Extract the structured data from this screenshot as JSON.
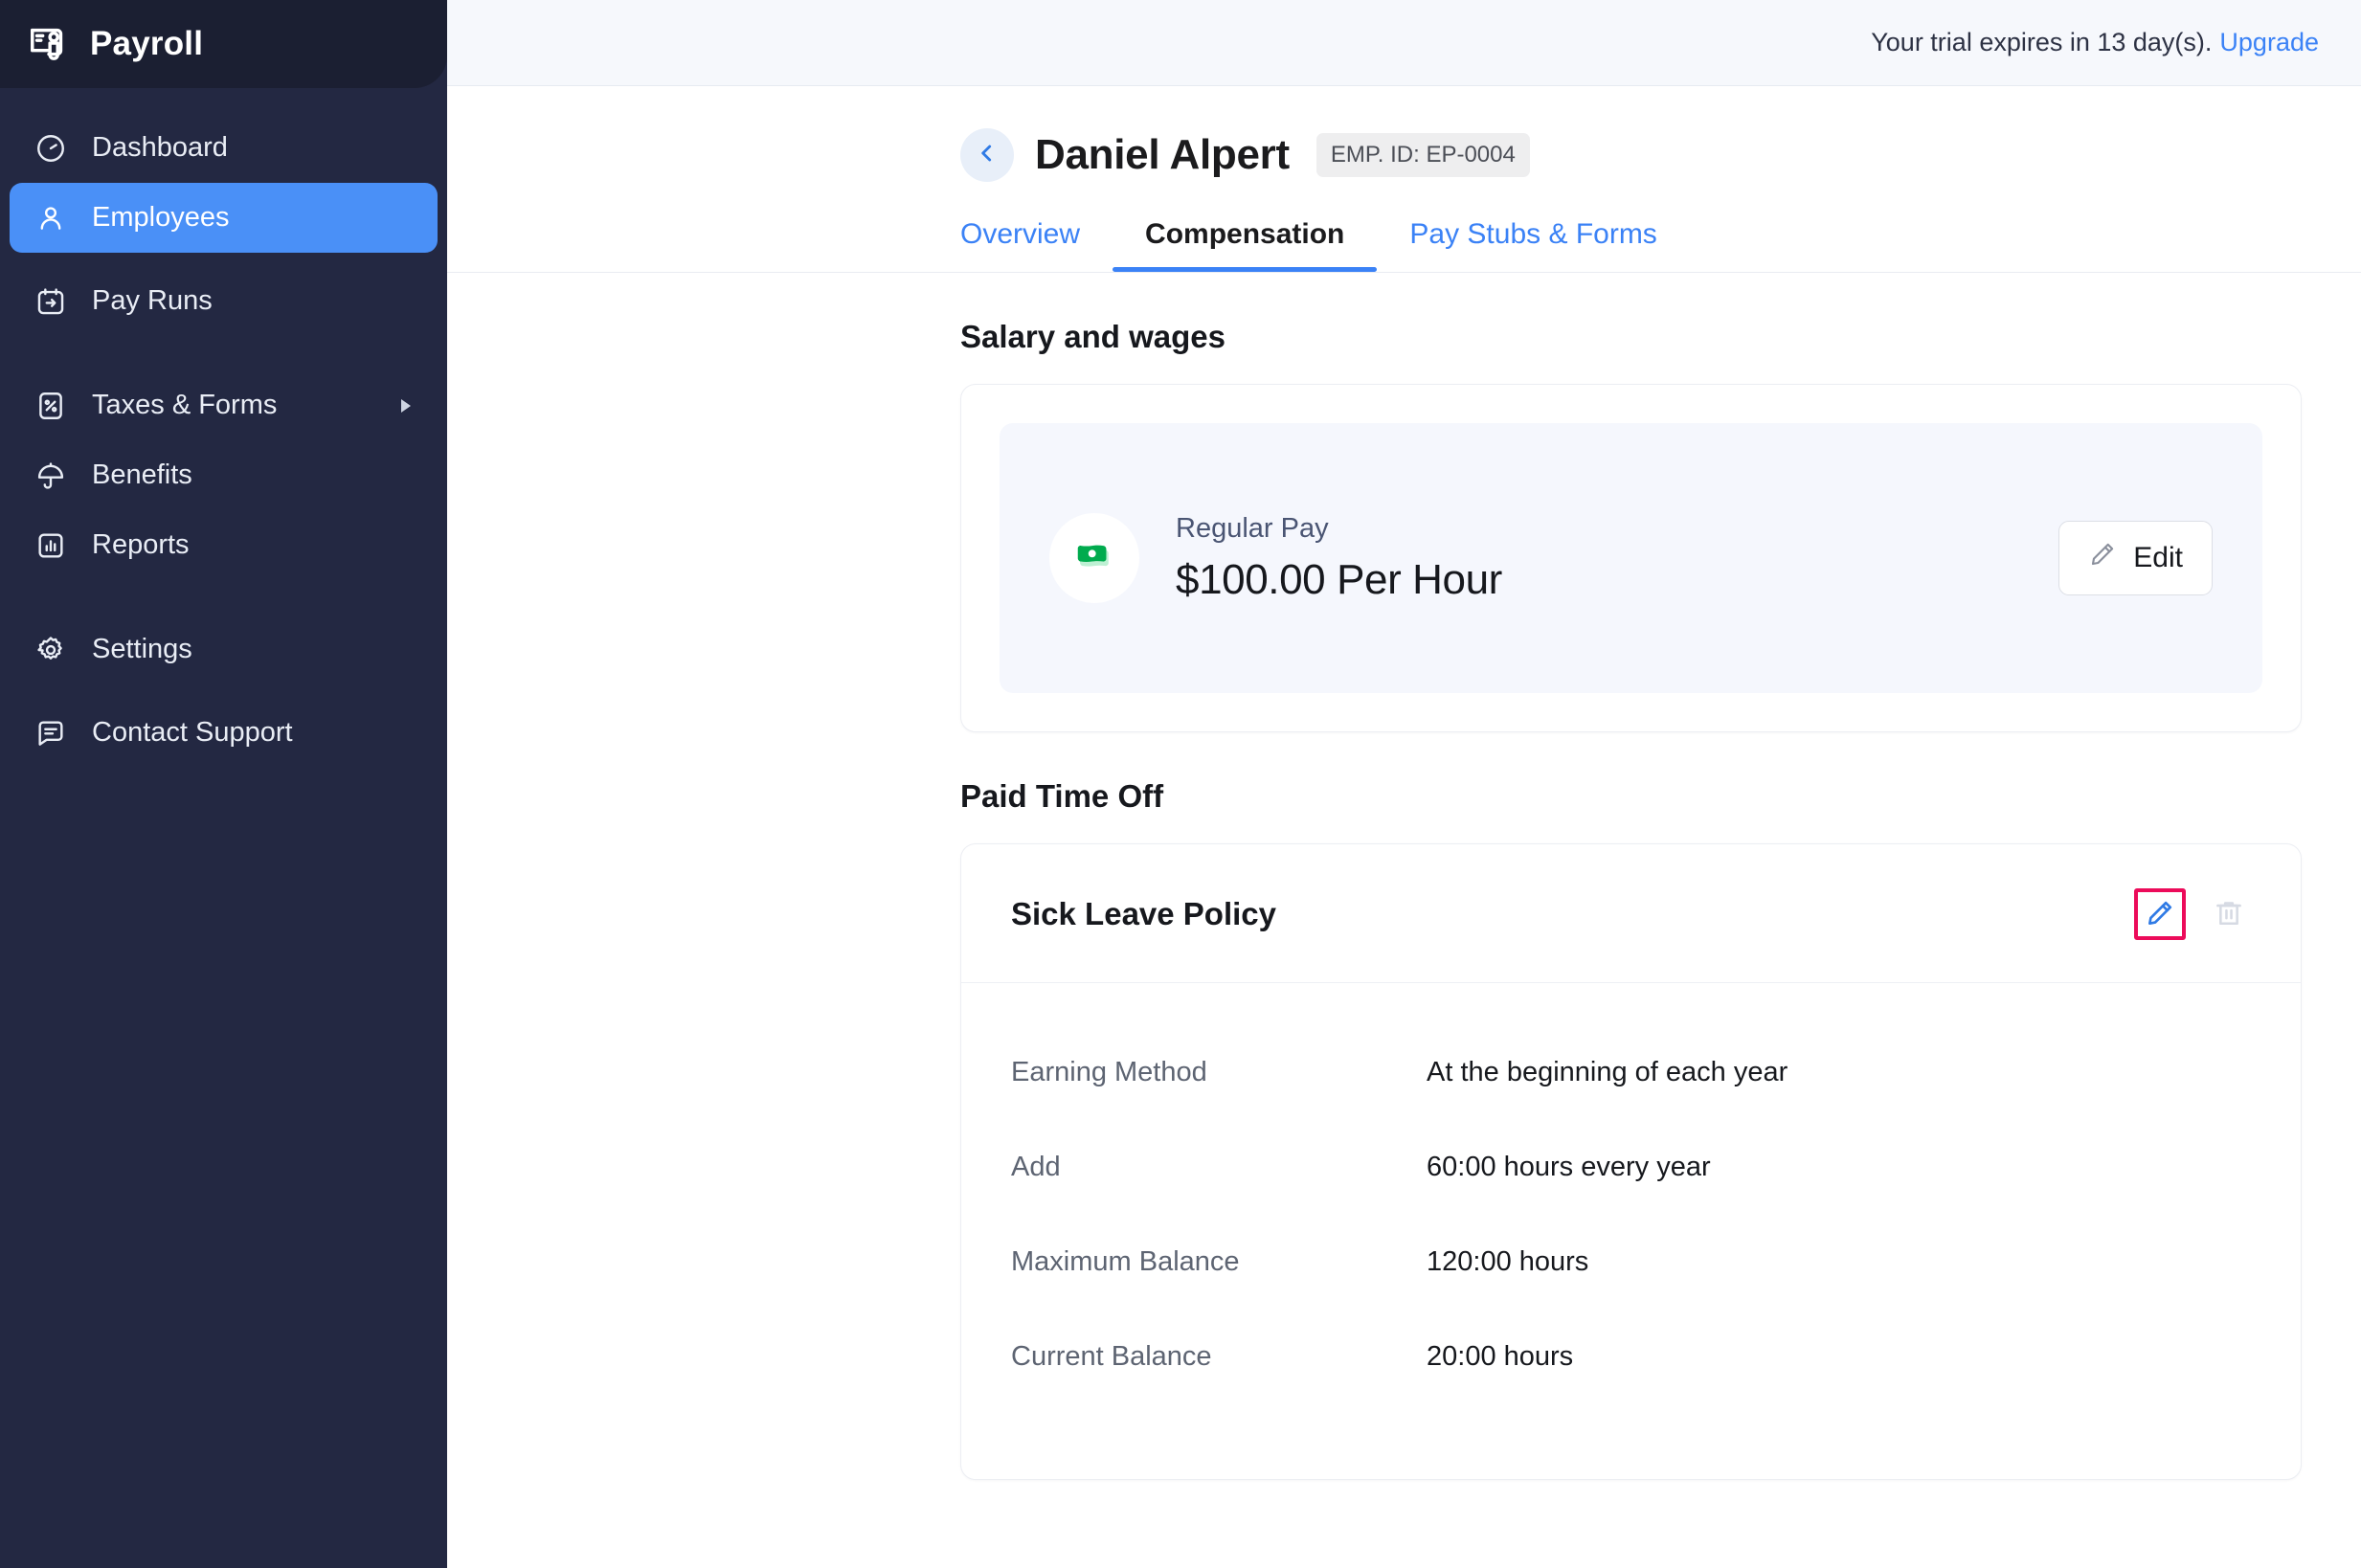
{
  "brand": {
    "title": "Payroll",
    "icon": "payroll-card-icon"
  },
  "sidebar": {
    "items": [
      {
        "label": "Dashboard",
        "icon": "gauge-icon",
        "active": false,
        "has_caret": false
      },
      {
        "label": "Employees",
        "icon": "user-icon",
        "active": true,
        "has_caret": false
      },
      {
        "label": "Pay Runs",
        "icon": "calendar-arrow-icon",
        "active": false,
        "has_caret": false
      },
      {
        "label": "Taxes & Forms",
        "icon": "percent-document-icon",
        "active": false,
        "has_caret": true
      },
      {
        "label": "Benefits",
        "icon": "umbrella-icon",
        "active": false,
        "has_caret": false
      },
      {
        "label": "Reports",
        "icon": "bar-chart-icon",
        "active": false,
        "has_caret": false
      },
      {
        "label": "Settings",
        "icon": "gear-icon",
        "active": false,
        "has_caret": false
      },
      {
        "label": "Contact Support",
        "icon": "chat-bubble-icon",
        "active": false,
        "has_caret": false
      }
    ]
  },
  "topbar": {
    "trial_text": "Your trial expires in 13 day(s).",
    "upgrade_label": "Upgrade"
  },
  "header": {
    "back_icon": "chevron-left-icon",
    "employee_name": "Daniel Alpert",
    "employee_id_badge": "EMP. ID: EP-0004"
  },
  "tabs": [
    {
      "label": "Overview",
      "active": false
    },
    {
      "label": "Compensation",
      "active": true
    },
    {
      "label": "Pay Stubs & Forms",
      "active": false
    }
  ],
  "salary": {
    "section_title": "Salary and wages",
    "icon": "money-bill-icon",
    "pay_label": "Regular Pay",
    "pay_amount": "$100.00 Per Hour",
    "edit_label": "Edit",
    "edit_icon": "pencil-icon"
  },
  "pto": {
    "section_title": "Paid Time Off",
    "policy_name": "Sick Leave Policy",
    "edit_icon": "pencil-icon",
    "delete_icon": "trash-icon",
    "rows": [
      {
        "key": "Earning Method",
        "value": "At the beginning of each year"
      },
      {
        "key": "Add",
        "value": "60:00 hours every year"
      },
      {
        "key": "Maximum Balance",
        "value": "120:00 hours"
      },
      {
        "key": "Current Balance",
        "value": "20:00 hours"
      }
    ]
  },
  "colors": {
    "sidebar_bg": "#232842",
    "sidebar_header_bg": "#1b1f32",
    "accent_blue": "#3b82f6",
    "active_nav_blue": "#4a90f7",
    "money_green": "#00ab4e",
    "highlight_pink": "#ec0b5a",
    "topbar_bg": "#f6f8fc",
    "inner_panel_bg": "#f5f7fd"
  }
}
